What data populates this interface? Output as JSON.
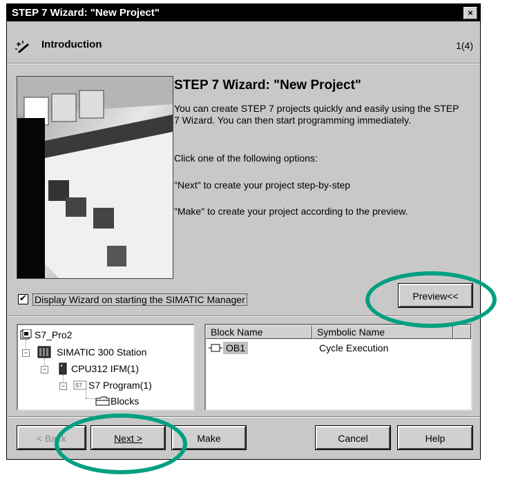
{
  "window": {
    "title": "STEP 7 Wizard: \"New Project\"",
    "close_glyph": "×"
  },
  "header": {
    "title": "Introduction",
    "step": "1(4)",
    "icon": "wand-icon"
  },
  "content": {
    "title": "STEP 7 Wizard: \"New Project\"",
    "para1": "You can create STEP 7 projects quickly and easily using the STEP 7 Wizard. You can then start programming immediately.",
    "para2": "Click one of the following options:",
    "para3": "\"Next\" to create your project step-by-step",
    "para4": "\"Make\" to create your project according to the preview."
  },
  "checkbox": {
    "label": "Display Wizard on starting the SIMATIC Manager",
    "checked": true
  },
  "preview_button": "Preview<<",
  "tree": {
    "items": [
      {
        "label": "S7_Pro2",
        "icon": "project-icon"
      },
      {
        "label": "SIMATIC 300 Station",
        "icon": "station-icon"
      },
      {
        "label": "CPU312 IFM(1)",
        "icon": "cpu-icon"
      },
      {
        "label": "S7 Program(1)",
        "icon": "program-icon"
      },
      {
        "label": "Blocks",
        "icon": "folder-icon"
      }
    ]
  },
  "table": {
    "columns": [
      "Block Name",
      "Symbolic Name"
    ],
    "rows": [
      {
        "block": "OB1",
        "symbolic": "Cycle Execution"
      }
    ]
  },
  "buttons": {
    "back": "< Back",
    "next": "Next >",
    "make": "Make",
    "cancel": "Cancel",
    "help": "Help"
  },
  "colors": {
    "annotation_circle": "#00a080"
  }
}
